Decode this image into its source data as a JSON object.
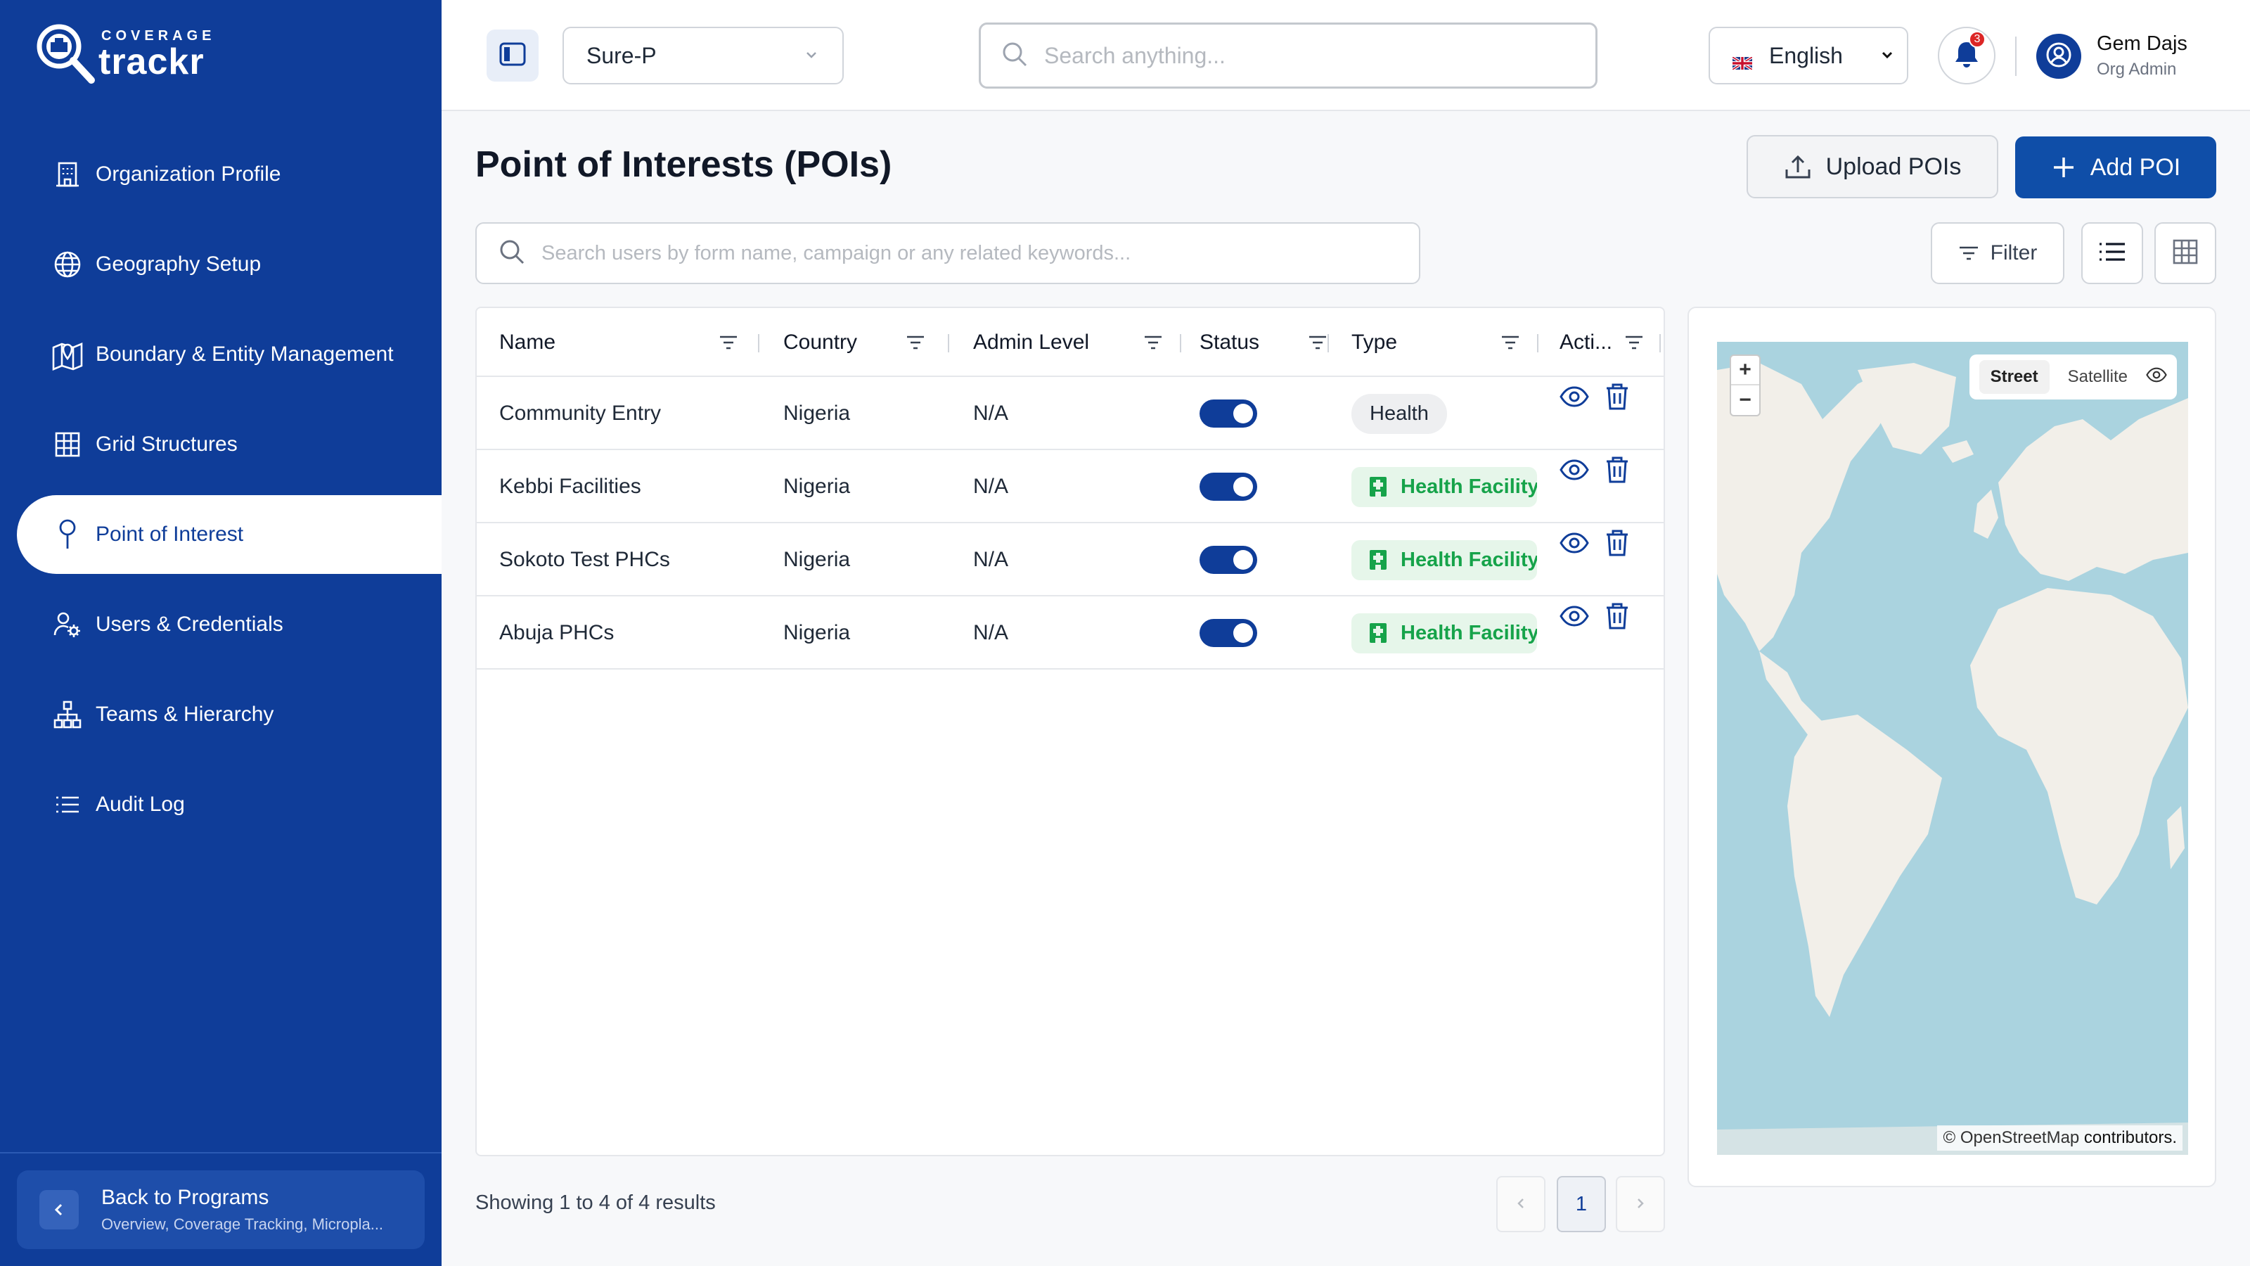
{
  "brand": {
    "sub": "COVERAGE",
    "name": "trackr"
  },
  "sidebar": {
    "items": [
      {
        "label": "Organization Profile",
        "icon": "building-icon"
      },
      {
        "label": "Geography Setup",
        "icon": "globe-icon"
      },
      {
        "label": "Boundary & Entity Management",
        "icon": "map-pin-icon"
      },
      {
        "label": "Grid Structures",
        "icon": "grid-icon"
      },
      {
        "label": "Point of Interest",
        "icon": "location-pin-icon",
        "active": true
      },
      {
        "label": "Users & Credentials",
        "icon": "users-gear-icon"
      },
      {
        "label": "Teams & Hierarchy",
        "icon": "hierarchy-icon"
      },
      {
        "label": "Audit Log",
        "icon": "list-icon"
      }
    ],
    "back": {
      "title": "Back to Programs",
      "subtitle": "Overview, Coverage Tracking, Micropla..."
    }
  },
  "topbar": {
    "program": "Sure-P",
    "search_placeholder": "Search anything...",
    "language": "English",
    "notification_count": "3",
    "user": {
      "name": "Gem Dajs",
      "role": "Org Admin"
    }
  },
  "page": {
    "title": "Point of Interests (POIs)",
    "upload_label": "Upload POIs",
    "add_label": "Add POI",
    "search_placeholder": "Search users by form name, campaign or any related keywords...",
    "filter_label": "Filter"
  },
  "table": {
    "columns": [
      "Name",
      "Country",
      "Admin Level",
      "Status",
      "Type",
      "Acti..."
    ],
    "rows": [
      {
        "name": "Community Entry",
        "country": "Nigeria",
        "admin_level": "N/A",
        "status": true,
        "type": "Health",
        "type_style": "gray"
      },
      {
        "name": "Kebbi Facilities",
        "country": "Nigeria",
        "admin_level": "N/A",
        "status": true,
        "type": "Health Facility",
        "type_style": "green"
      },
      {
        "name": "Sokoto Test PHCs",
        "country": "Nigeria",
        "admin_level": "N/A",
        "status": true,
        "type": "Health Facility",
        "type_style": "green"
      },
      {
        "name": "Abuja PHCs",
        "country": "Nigeria",
        "admin_level": "N/A",
        "status": true,
        "type": "Health Facility",
        "type_style": "green"
      }
    ]
  },
  "pagination": {
    "summary": "Showing 1 to 4 of 4 results",
    "current_page": "1"
  },
  "map": {
    "zoom_in": "+",
    "zoom_out": "−",
    "style_street": "Street",
    "style_satellite": "Satellite",
    "attribution_prefix": "© OpenStreetMap",
    "attribution_suffix": " contributors."
  },
  "colors": {
    "primary": "#0f3d99",
    "accent_button": "#0f4ea8",
    "success": "#16a34a",
    "water": "#aad3df",
    "land": "#f2efe9"
  }
}
